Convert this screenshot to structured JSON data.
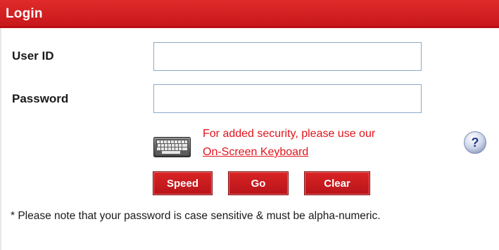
{
  "header": {
    "title": "Login",
    "accent_color": "#d21f24"
  },
  "form": {
    "user_id_label": "User ID",
    "user_id_value": "",
    "password_label": "Password",
    "password_value": ""
  },
  "security": {
    "message": "For added security, please use our",
    "link_text": "On-Screen Keyboard",
    "keyboard_icon": "keyboard-icon",
    "help_icon": "help-icon",
    "help_glyph": "?"
  },
  "buttons": {
    "speed_label": "Speed",
    "go_label": "Go",
    "clear_label": "Clear"
  },
  "note": {
    "text": "* Please note that your password is case sensitive & must be alpha-numeric."
  }
}
